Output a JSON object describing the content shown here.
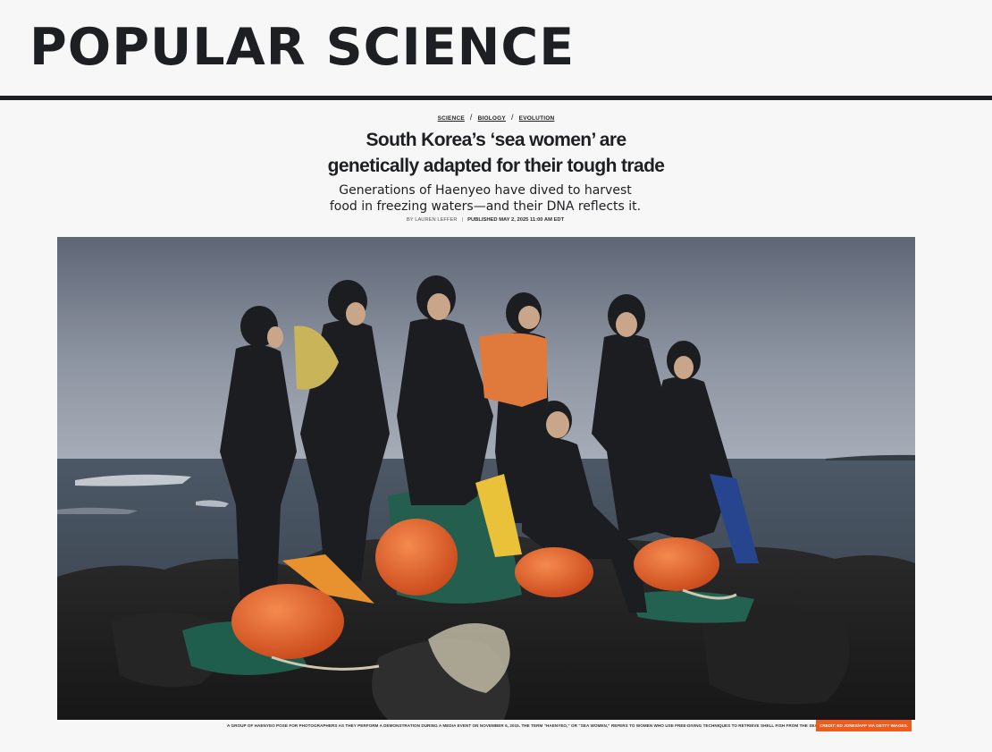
{
  "masthead": {
    "logo_word1": "POPULAR",
    "logo_word2": "SCIENCE"
  },
  "breadcrumb": {
    "items": [
      "SCIENCE",
      "BIOLOGY",
      "EVOLUTION"
    ],
    "separator": "/"
  },
  "article": {
    "headline_line1": "South Korea’s ‘sea women’ are",
    "headline_line2": "genetically adapted for their tough trade",
    "dek_line1": "Generations of Haenyeo have dived to harvest",
    "dek_line2": "food in freezing waters—and their DNA reflects it.",
    "byline_prefix": "BY",
    "author": "LAUREN LEFFER",
    "published_label": "PUBLISHED MAY 2, 2025 11:00 AM EDT"
  },
  "hero": {
    "alt": "A group of Haenyeo posing on volcanic rocks by the sea",
    "caption": "A GROUP OF HAENYEO POSE FOR PHOTOGRAPHERS AS THEY PERFORM A DEMONSTRATION DURING A MEDIA EVENT ON NOVEMBER 6, 2015. THE TERM “HAENYEO,” OR “SEA WOMEN,” REFERS TO WOMEN WHO USE FREE-DIVING TECHNIQUES TO RETRIEVE SHELL FISH FROM THE SEA FLOOR.",
    "credit": "CREDIT: ED JONES/AFP VIA GETTY IMAGES."
  },
  "colors": {
    "text": "#1d1f22",
    "background": "#f7f7f7",
    "credit_badge": "#f05a1a",
    "buoy_orange": "#e8612a"
  }
}
